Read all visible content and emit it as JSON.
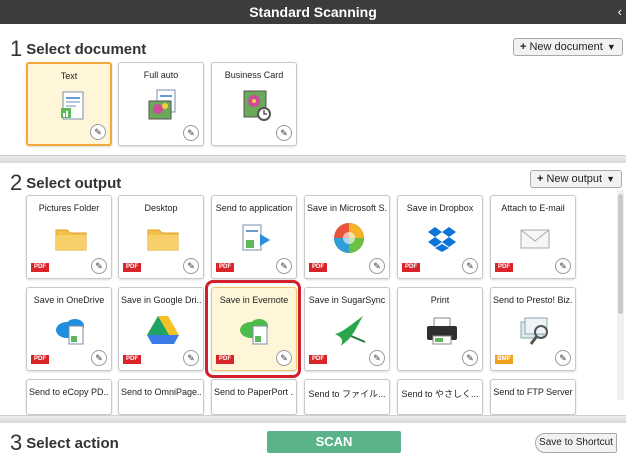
{
  "title": "Standard Scanning",
  "collapse_glyph": "‹",
  "sections": {
    "document": {
      "num": "1",
      "label": "Select document",
      "new_button": "New document"
    },
    "output": {
      "num": "2",
      "label": "Select output",
      "new_button": "New output"
    },
    "action": {
      "num": "3",
      "label": "Select action",
      "scan_button": "SCAN",
      "shortcut_button": "Save to Shortcut"
    }
  },
  "documents": [
    {
      "label": "Text",
      "selected": true
    },
    {
      "label": "Full auto"
    },
    {
      "label": "Business Card"
    }
  ],
  "outputs_row1": [
    {
      "label": "Pictures Folder",
      "badge": "PDF"
    },
    {
      "label": "Desktop",
      "badge": "PDF"
    },
    {
      "label": "Send to application",
      "badge": "PDF"
    },
    {
      "label": "Save in Microsoft S...",
      "badge": "PDF"
    },
    {
      "label": "Save in Dropbox",
      "badge": "PDF"
    },
    {
      "label": "Attach to E-mail",
      "badge": "PDF"
    }
  ],
  "outputs_row2": [
    {
      "label": "Save in OneDrive",
      "badge": "PDF"
    },
    {
      "label": "Save in Google Dri...",
      "badge": "PDF"
    },
    {
      "label": "Save in Evernote",
      "badge": "PDF"
    },
    {
      "label": "Save in SugarSync",
      "badge": "PDF"
    },
    {
      "label": "Print",
      "badge": ""
    },
    {
      "label": "Send to Presto! Biz...",
      "badge": "BMP"
    }
  ],
  "outputs_row3": [
    {
      "label": "Send to eCopy PD..."
    },
    {
      "label": "Send to OmniPage..."
    },
    {
      "label": "Send to PaperPort ..."
    },
    {
      "label": "Send to ファイル..."
    },
    {
      "label": "Send to やさしく..."
    },
    {
      "label": "Send to FTP Server"
    }
  ],
  "colors": {
    "titlebar": "#3c3c3c",
    "scan": "#5bb389",
    "highlight": "#d21f2e",
    "selected_border": "#f3a93a",
    "pdf_badge": "#d9252a"
  }
}
